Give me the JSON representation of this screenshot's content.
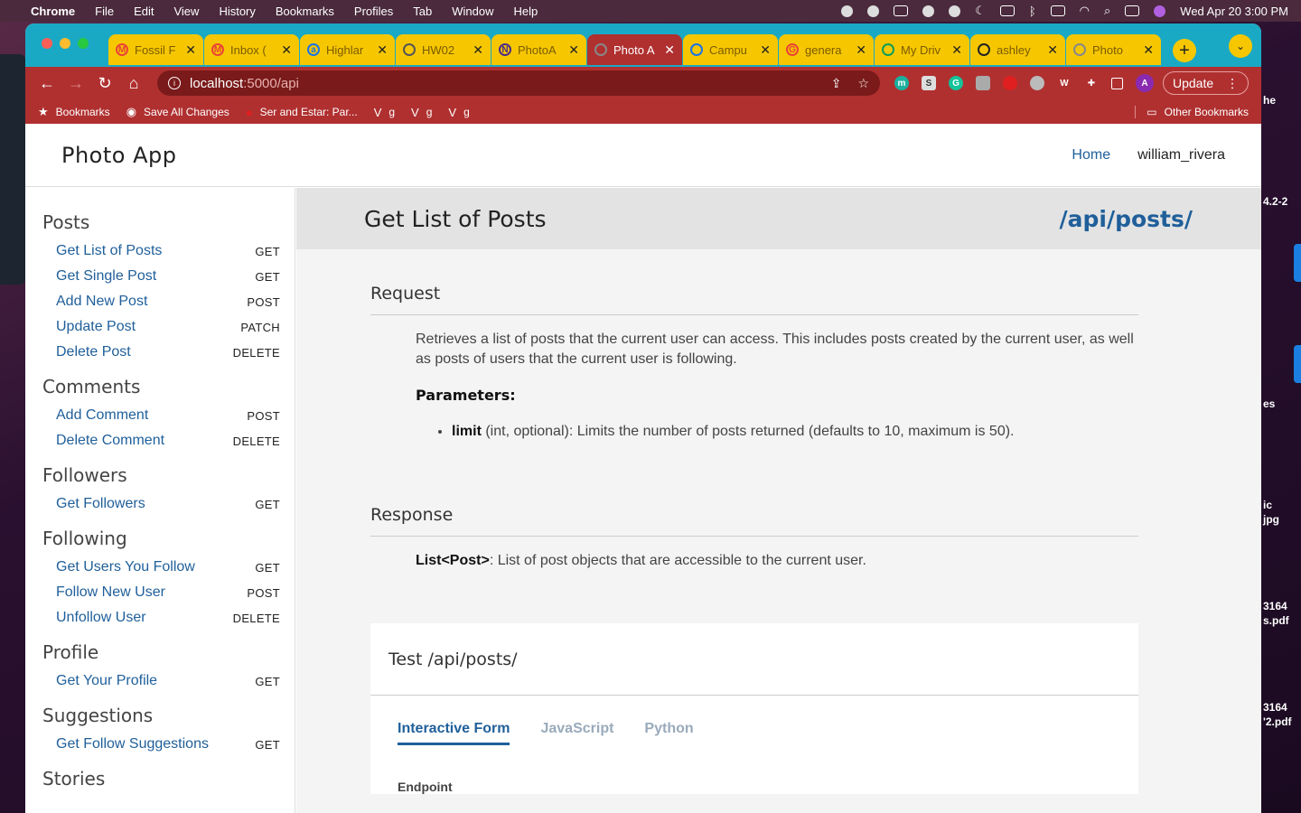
{
  "menubar": {
    "app": "Chrome",
    "items": [
      "File",
      "Edit",
      "View",
      "History",
      "Bookmarks",
      "Profiles",
      "Tab",
      "Window",
      "Help"
    ],
    "clock": "Wed Apr 20  3:00 PM"
  },
  "tabs": [
    {
      "title": "Fossil F",
      "fav": "M",
      "color": "#ea4335"
    },
    {
      "title": "Inbox (",
      "fav": "M",
      "color": "#ea4335"
    },
    {
      "title": "Highlar",
      "fav": "a",
      "color": "#1a73e8"
    },
    {
      "title": "HW02",
      "fav": "",
      "color": "#555"
    },
    {
      "title": "PhotoA",
      "fav": "N",
      "color": "#4a2a8a"
    },
    {
      "title": "Photo A",
      "fav": "",
      "color": "#888",
      "active": true
    },
    {
      "title": "Campu",
      "fav": "",
      "color": "#1a73e8"
    },
    {
      "title": "genera",
      "fav": "G",
      "color": "#ea4335"
    },
    {
      "title": "My Driv",
      "fav": "",
      "color": "#0f9d58"
    },
    {
      "title": "ashley",
      "fav": "",
      "color": "#222"
    },
    {
      "title": "Photo",
      "fav": "",
      "color": "#888"
    }
  ],
  "omnibox": {
    "host": "localhost",
    "path": ":5000/api"
  },
  "update_label": "Update",
  "bookmarks": {
    "items": [
      "Bookmarks",
      "Save All Changes",
      "Ser and Estar: Par...",
      "g",
      "g",
      "g"
    ],
    "other": "Other Bookmarks"
  },
  "desktop": {
    "right_texts": [
      "he",
      "4.2-2",
      "es",
      "ic",
      "jpg",
      "3164",
      "s.pdf",
      "3164",
      "'2.pdf"
    ]
  },
  "app": {
    "title": "Photo App",
    "nav_home": "Home",
    "username": "william_rivera"
  },
  "sidebar": [
    {
      "title": "Posts",
      "items": [
        {
          "label": "Get List of Posts",
          "verb": "GET"
        },
        {
          "label": "Get Single Post",
          "verb": "GET"
        },
        {
          "label": "Add New Post",
          "verb": "POST"
        },
        {
          "label": "Update Post",
          "verb": "PATCH"
        },
        {
          "label": "Delete Post",
          "verb": "DELETE"
        }
      ]
    },
    {
      "title": "Comments",
      "items": [
        {
          "label": "Add Comment",
          "verb": "POST"
        },
        {
          "label": "Delete Comment",
          "verb": "DELETE"
        }
      ]
    },
    {
      "title": "Followers",
      "items": [
        {
          "label": "Get Followers",
          "verb": "GET"
        }
      ]
    },
    {
      "title": "Following",
      "items": [
        {
          "label": "Get Users You Follow",
          "verb": "GET"
        },
        {
          "label": "Follow New User",
          "verb": "POST"
        },
        {
          "label": "Unfollow User",
          "verb": "DELETE"
        }
      ]
    },
    {
      "title": "Profile",
      "items": [
        {
          "label": "Get Your Profile",
          "verb": "GET"
        }
      ]
    },
    {
      "title": "Suggestions",
      "items": [
        {
          "label": "Get Follow Suggestions",
          "verb": "GET"
        }
      ]
    },
    {
      "title": "Stories",
      "items": []
    }
  ],
  "main": {
    "title": "Get List of Posts",
    "endpoint": "/api/posts/",
    "request": {
      "heading": "Request",
      "description": "Retrieves a list of posts that the current user can access. This includes posts created by the current user, as well as posts of users that the current user is following.",
      "params_heading": "Parameters:",
      "param_name": "limit",
      "param_desc": " (int, optional): Limits the number of posts returned (defaults to 10, maximum is 50)."
    },
    "response": {
      "heading": "Response",
      "type": "List<Post>",
      "desc": ": List of post objects that are accessible to the current user."
    },
    "test": {
      "heading": "Test /api/posts/",
      "tabs": [
        "Interactive Form",
        "JavaScript",
        "Python"
      ],
      "endpoint_label": "Endpoint"
    }
  }
}
